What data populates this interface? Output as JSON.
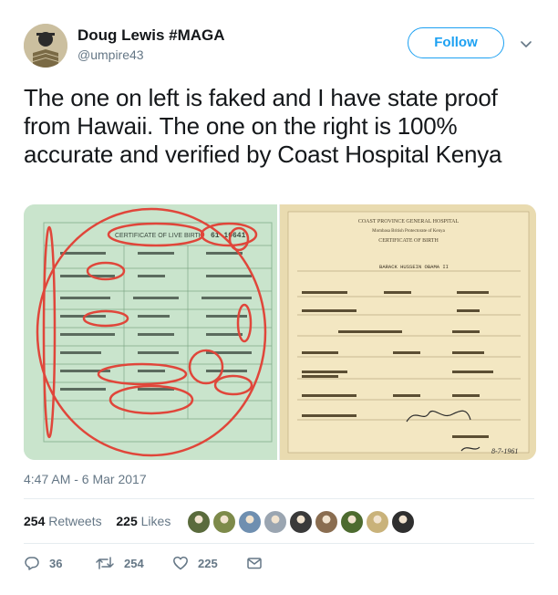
{
  "author": {
    "name": "Doug Lewis #MAGA",
    "handle": "@umpire43",
    "avatar_icon": "user-avatar"
  },
  "follow_label": "Follow",
  "tweet_text": "The one on left is faked and I have state proof from Hawaii. The one on the right is 100% accurate and verified by Coast Hospital Kenya",
  "media": {
    "left_doc": {
      "heading": "CERTIFICATE OF LIVE BIRTH",
      "number": "61 10641"
    },
    "right_doc": {
      "hospital": "COAST PROVINCE GENERAL HOSPITAL",
      "subheading": "Mombasa British Protectorate of Kenya",
      "title": "CERTIFICATE OF BIRTH",
      "child_name": "BARACK HUSSEIN OBAMA II",
      "date": "8-7-1961"
    }
  },
  "timestamp": "4:47 AM - 6 Mar 2017",
  "stats": {
    "retweets_count": "254",
    "retweets_label": "Retweets",
    "likes_count": "225",
    "likes_label": "Likes"
  },
  "likers": [
    "#5a6b3c",
    "#7d8a4a",
    "#6f8fb0",
    "#9aa5b1",
    "#3a3a3a",
    "#8a6d50",
    "#4d6b2f",
    "#c9b27a",
    "#2f2f2f"
  ],
  "actions": {
    "reply_count": "36",
    "retweet_count": "254",
    "like_count": "225"
  },
  "colors": {
    "accent": "#1da1f2",
    "secondary_text": "#657786",
    "annotation_red": "#e0463a"
  }
}
